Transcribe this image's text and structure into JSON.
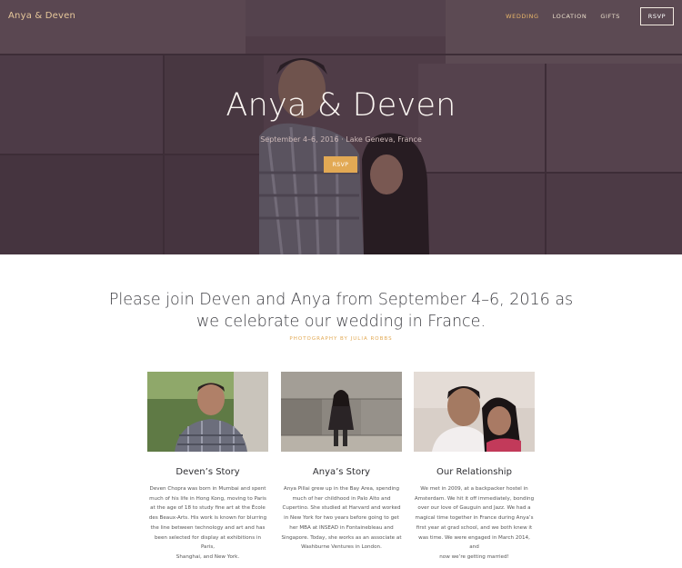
{
  "header": {
    "brand": "Anya & Deven",
    "nav": [
      "WEDDING",
      "LOCATION",
      "GIFTS"
    ],
    "rsvp": "RSVP"
  },
  "hero": {
    "title": "Anya & Deven",
    "subtitle": "September 4–6, 2016 · Lake Geneva, France",
    "rsvp": "RSVP"
  },
  "intro": {
    "line1": "Please join Deven and Anya from September 4–6, 2016 as",
    "line2": "we celebrate our wedding in France.",
    "credit": "PHOTOGRAPHY BY JULIA ROBBS"
  },
  "cards": [
    {
      "title": "Deven’s Story",
      "lines": [
        "Deven Chopra was born in Mumbai and spent",
        "much of his life in Hong Kong, moving to Paris",
        "at the age of 18 to study fine art at the École",
        "des Beaux-Arts. His work is known for blurring",
        "the line between technology and art and has",
        "been selected for display at exhibitions in Paris,",
        "Shanghai, and New York."
      ]
    },
    {
      "title": "Anya’s Story",
      "lines": [
        "Anya Pillai grew up in the Bay Area, spending",
        "much of her childhood in Palo Alto and",
        "Cupertino. She studied at Harvard and worked",
        "in New York for two years before going to get",
        "her MBA at INSEAD in Fontainebleau and",
        "Singapore. Today, she works as an associate at",
        "Washburne Ventures in London."
      ]
    },
    {
      "title": "Our Relationship",
      "lines": [
        "We met in 2009, at a backpacker hostel in",
        "Amsterdam. We hit it off immediately, bonding",
        "over our love of Gauguin and Jazz. We had a",
        "magical time together in France during Anya’s",
        "first year at grad school, and we both knew it",
        "was time. We were engaged in March 2014, and",
        "now we’re getting married!"
      ]
    }
  ],
  "colors": {
    "accent": "#e2a954",
    "hero_tint": "#4a3a42"
  }
}
